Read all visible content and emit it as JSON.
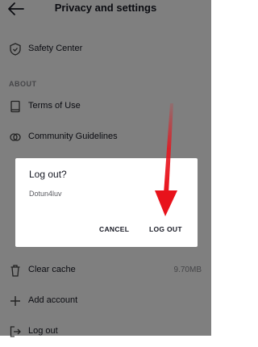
{
  "header": {
    "title": "Privacy and settings"
  },
  "rows": [
    {
      "label": "Safety Center",
      "icon": "shield-icon"
    },
    {
      "label": "Terms of Use",
      "icon": "book-icon"
    },
    {
      "label": "Community Guidelines",
      "icon": "rings-icon"
    },
    {
      "label": "Clear cache",
      "value": "9.70MB",
      "icon": "trash-icon"
    },
    {
      "label": "Add account",
      "icon": "plus-icon"
    },
    {
      "label": "Log out",
      "icon": "logout-icon"
    }
  ],
  "section": {
    "about": "ABOUT"
  },
  "dialog": {
    "title": "Log out?",
    "username": "Dotun4luv",
    "cancel": "CANCEL",
    "confirm": "LOG OUT"
  },
  "colors": {
    "overlay": "#00000080",
    "arrow": "#e8121b"
  }
}
